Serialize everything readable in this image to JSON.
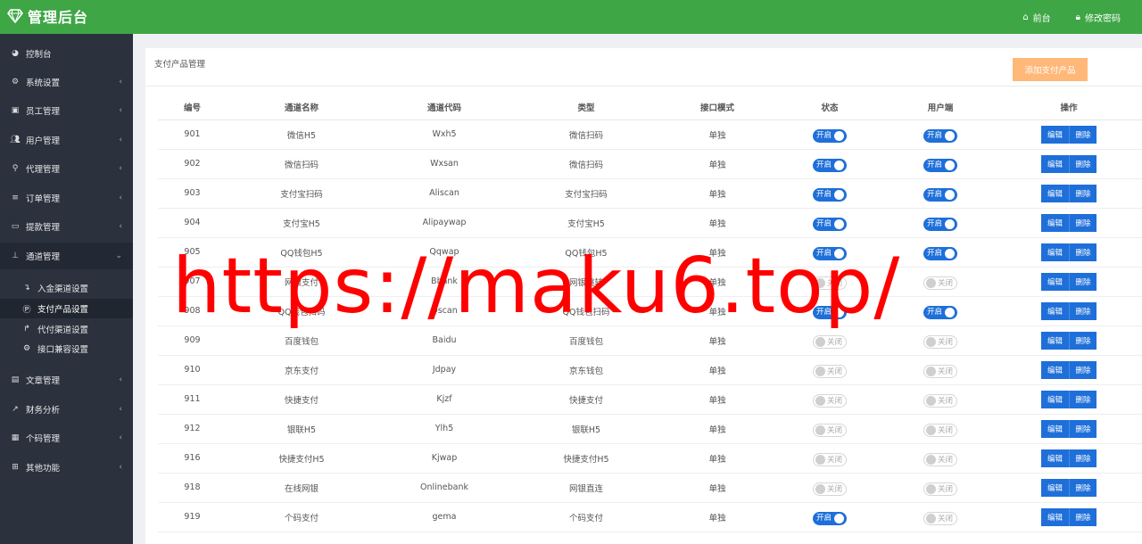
{
  "app": {
    "title": "管理后台",
    "brand_icon": "diamond-icon"
  },
  "header": {
    "links": [
      {
        "label": "前台",
        "icon": "home-icon"
      },
      {
        "label": "修改密码",
        "icon": "lock-icon"
      }
    ]
  },
  "sidebar": {
    "items": [
      {
        "label": "控制台",
        "icon": "dashboard-icon"
      },
      {
        "label": "系统设置",
        "icon": "cogs-icon"
      },
      {
        "label": "员工管理",
        "icon": "id-card-icon"
      },
      {
        "label": "用户管理",
        "icon": "users-icon"
      },
      {
        "label": "代理管理",
        "icon": "user-tie-icon"
      },
      {
        "label": "订单管理",
        "icon": "list-icon"
      },
      {
        "label": "提款管理",
        "icon": "credit-card-icon"
      },
      {
        "label": "通道管理",
        "icon": "sitemap-icon"
      },
      {
        "label": "文章管理",
        "icon": "book-icon"
      },
      {
        "label": "财务分析",
        "icon": "line-chart-icon"
      },
      {
        "label": "个码管理",
        "icon": "qrcode-icon"
      },
      {
        "label": "其他功能",
        "icon": "plus-square-icon"
      }
    ],
    "sub_items": [
      {
        "label": "入金渠道设置",
        "icon": "level-down-icon"
      },
      {
        "label": "支付产品设置",
        "icon": "product-hunt-icon"
      },
      {
        "label": "代付渠道设置",
        "icon": "level-up-icon"
      },
      {
        "label": "接口兼容设置",
        "icon": "cogs-icon"
      }
    ]
  },
  "panel": {
    "title": "支付产品管理",
    "add_button": "添加支付产品",
    "add_button_color": "#ffb878"
  },
  "table": {
    "headers": [
      "编号",
      "通道名称",
      "通道代码",
      "类型",
      "接口模式",
      "状态",
      "用户端",
      "操作"
    ],
    "on_label": "开启",
    "off_label": "关闭",
    "edit_label": "编辑",
    "delete_label": "删除",
    "rows": [
      {
        "id": "901",
        "name": "微信H5",
        "code": "Wxh5",
        "type": "微信扫码",
        "mode": "单独",
        "status_on": true,
        "client_on": true
      },
      {
        "id": "902",
        "name": "微信扫码",
        "code": "Wxsan",
        "type": "微信扫码",
        "mode": "单独",
        "status_on": true,
        "client_on": true
      },
      {
        "id": "903",
        "name": "支付宝扫码",
        "code": "Aliscan",
        "type": "支付宝扫码",
        "mode": "单独",
        "status_on": true,
        "client_on": true
      },
      {
        "id": "904",
        "name": "支付宝H5",
        "code": "Alipaywap",
        "type": "支付宝H5",
        "mode": "单独",
        "status_on": true,
        "client_on": true
      },
      {
        "id": "905",
        "name": "QQ钱包H5",
        "code": "Qqwap",
        "type": "QQ钱包H5",
        "mode": "单独",
        "status_on": true,
        "client_on": true
      },
      {
        "id": "907",
        "name": "网银支付",
        "code": "Bbank",
        "type": "网银跳转",
        "mode": "单独",
        "status_on": false,
        "client_on": false
      },
      {
        "id": "908",
        "name": "QQ钱包扫码",
        "code": "Qscan",
        "type": "QQ钱包扫码",
        "mode": "单独",
        "status_on": true,
        "client_on": true
      },
      {
        "id": "909",
        "name": "百度钱包",
        "code": "Baidu",
        "type": "百度钱包",
        "mode": "单独",
        "status_on": false,
        "client_on": false
      },
      {
        "id": "910",
        "name": "京东支付",
        "code": "Jdpay",
        "type": "京东钱包",
        "mode": "单独",
        "status_on": false,
        "client_on": false
      },
      {
        "id": "911",
        "name": "快捷支付",
        "code": "Kjzf",
        "type": "快捷支付",
        "mode": "单独",
        "status_on": false,
        "client_on": false
      },
      {
        "id": "912",
        "name": "银联H5",
        "code": "Ylh5",
        "type": "银联H5",
        "mode": "单独",
        "status_on": false,
        "client_on": false
      },
      {
        "id": "916",
        "name": "快捷支付H5",
        "code": "Kjwap",
        "type": "快捷支付H5",
        "mode": "单独",
        "status_on": false,
        "client_on": false
      },
      {
        "id": "918",
        "name": "在线网银",
        "code": "Onlinebank",
        "type": "网银直连",
        "mode": "单独",
        "status_on": false,
        "client_on": false
      },
      {
        "id": "919",
        "name": "个码支付",
        "code": "gema",
        "type": "个码支付",
        "mode": "单独",
        "status_on": true,
        "client_on": false
      }
    ]
  },
  "watermark": {
    "text": "https://maku6.top/",
    "color": "#ff0000"
  },
  "colors": {
    "header_green": "#3fa646",
    "sidebar_bg": "#2b323e",
    "primary_blue": "#1e6fd9"
  }
}
